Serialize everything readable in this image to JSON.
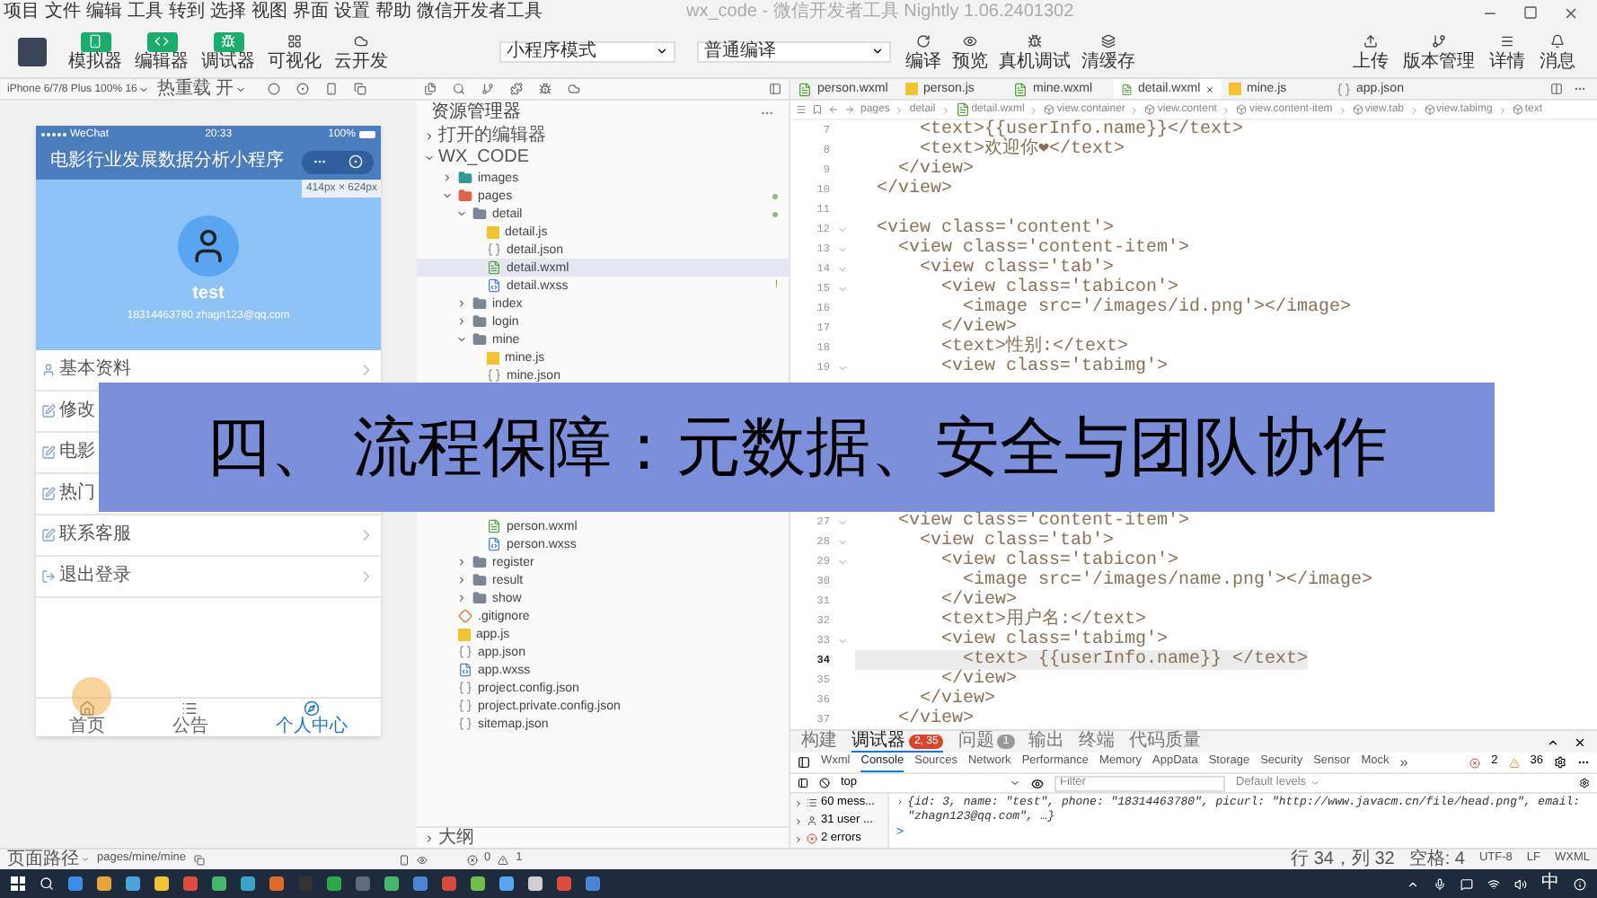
{
  "window": {
    "menu": [
      "项目",
      "文件",
      "编辑",
      "工具",
      "转到",
      "选择",
      "视图",
      "界面",
      "设置",
      "帮助",
      "微信开发者工具"
    ],
    "title": "wx_code - 微信开发者工具 Nightly 1.06.2401302"
  },
  "toolbar": {
    "toggles": [
      {
        "label": "模拟器",
        "kind": "phone",
        "on": true
      },
      {
        "label": "编辑器",
        "kind": "code",
        "on": true
      },
      {
        "label": "调试器",
        "kind": "debug",
        "on": true
      },
      {
        "label": "可视化",
        "kind": "grid",
        "on": false
      },
      {
        "label": "云开发",
        "kind": "cloud",
        "on": false
      }
    ],
    "mode": "小程序模式",
    "compile_mode": "普通编译",
    "actions": [
      {
        "label": "编译",
        "kind": "refresh"
      },
      {
        "label": "预览",
        "kind": "eye"
      },
      {
        "label": "真机调试",
        "kind": "bug"
      },
      {
        "label": "清缓存",
        "kind": "layers"
      }
    ],
    "right_actions": [
      {
        "label": "上传",
        "kind": "upload"
      },
      {
        "label": "版本管理",
        "kind": "branch"
      },
      {
        "label": "详情",
        "kind": "menu"
      },
      {
        "label": "消息",
        "kind": "bell"
      }
    ]
  },
  "simulator": {
    "device": "iPhone 6/7/8 Plus 100% 16",
    "hot_reload": "热重载 开",
    "status": {
      "carrier": "WeChat",
      "time": "20:33",
      "battery": "100%"
    },
    "nav_title": "电影行业发展数据分析小程序",
    "size_badge": "414px × 624px",
    "profile": {
      "name": "test",
      "contact": "18314463780 zhagn123@qq.com"
    },
    "menu": [
      {
        "label": "基本资料",
        "kind": "user",
        "chevron": true
      },
      {
        "label": "修改",
        "kind": "edit"
      },
      {
        "label": "电影",
        "kind": "edit"
      },
      {
        "label": "热门",
        "kind": "edit"
      },
      {
        "label": "联系客服",
        "kind": "edit",
        "chevron": true
      },
      {
        "label": "退出登录",
        "kind": "logout",
        "chevron": true
      }
    ],
    "tabbar": [
      {
        "label": "首页",
        "kind": "home",
        "selected": false
      },
      {
        "label": "公告",
        "kind": "list",
        "selected": false
      },
      {
        "label": "个人中心",
        "kind": "compass",
        "selected": true
      }
    ],
    "touch": true
  },
  "file_tree": {
    "title": "资源管理器",
    "sections": [
      {
        "name": "打开的编辑器",
        "expanded": false
      },
      {
        "name": "WX_CODE",
        "expanded": true,
        "items": [
          {
            "name": "images",
            "kind": "folder",
            "color": "#2f9a8f",
            "expanded": false,
            "selected": false
          },
          {
            "name": "pages",
            "kind": "folder",
            "color": "#e0604a",
            "expanded": true,
            "modified": true,
            "selected": false,
            "children": [
              {
                "name": "detail",
                "kind": "folder",
                "color": "#7a8797",
                "expanded": true,
                "modified": true,
                "selected": false,
                "children": [
                  {
                    "name": "detail.js",
                    "kind": "js",
                    "selected": false
                  },
                  {
                    "name": "detail.json",
                    "kind": "json",
                    "selected": false
                  },
                  {
                    "name": "detail.wxml",
                    "kind": "wxml",
                    "selected": true
                  },
                  {
                    "name": "detail.wxss",
                    "kind": "wxss",
                    "selected": false,
                    "badge": "!"
                  }
                ]
              },
              {
                "name": "index",
                "kind": "folder",
                "color": "#7a8797",
                "expanded": false,
                "selected": false
              },
              {
                "name": "login",
                "kind": "folder",
                "color": "#7a8797",
                "expanded": false,
                "selected": false
              },
              {
                "name": "mine",
                "kind": "folder",
                "color": "#7a8797",
                "expanded": true,
                "selected": false,
                "children": [
                  {
                    "name": "mine.js",
                    "kind": "js",
                    "selected": false
                  },
                  {
                    "name": "mine.json",
                    "kind": "json",
                    "selected": false
                  }
                ]
              },
              {
                "kind": "hidden",
                "children": [
                  {
                    "name": "person.wxml",
                    "kind": "wxml",
                    "selected": false
                  },
                  {
                    "name": "person.wxss",
                    "kind": "wxss",
                    "selected": false
                  }
                ]
              },
              {
                "name": "register",
                "kind": "folder",
                "color": "#7a8797",
                "expanded": false,
                "selected": false
              },
              {
                "name": "result",
                "kind": "folder",
                "color": "#7a8797",
                "expanded": false,
                "selected": false
              },
              {
                "name": "show",
                "kind": "folder",
                "color": "#7a8797",
                "expanded": false,
                "selected": false
              }
            ]
          },
          {
            "name": ".gitignore",
            "kind": "git",
            "selected": false
          },
          {
            "name": "app.js",
            "kind": "js",
            "selected": false
          },
          {
            "name": "app.json",
            "kind": "json",
            "selected": false
          },
          {
            "name": "app.wxss",
            "kind": "wxss",
            "selected": false
          },
          {
            "name": "project.config.json",
            "kind": "json",
            "selected": false
          },
          {
            "name": "project.private.config.json",
            "kind": "json",
            "selected": false
          },
          {
            "name": "sitemap.json",
            "kind": "json",
            "selected": false
          }
        ]
      }
    ],
    "outline": "大纲"
  },
  "editor": {
    "tabs": [
      {
        "name": "person.wxml",
        "kind": "wxml",
        "selected": false
      },
      {
        "name": "person.js",
        "kind": "js",
        "selected": false
      },
      {
        "name": "mine.wxml",
        "kind": "wxml",
        "selected": false
      },
      {
        "name": "detail.wxml",
        "kind": "wxml",
        "selected": true
      },
      {
        "name": "mine.js",
        "kind": "js",
        "selected": false
      },
      {
        "name": "app.json",
        "kind": "json",
        "selected": false
      }
    ],
    "breadcrumb": [
      {
        "label": "pages",
        "kind": "plain"
      },
      {
        "label": "detail",
        "kind": "plain"
      },
      {
        "label": "detail.wxml",
        "kind": "wxml"
      },
      {
        "label": "view.container",
        "kind": "element"
      },
      {
        "label": "view.content",
        "kind": "element"
      },
      {
        "label": "view.content-item",
        "kind": "element"
      },
      {
        "label": "view.tab",
        "kind": "element"
      },
      {
        "label": "view.tabimg",
        "kind": "element"
      },
      {
        "label": "text",
        "kind": "element"
      }
    ],
    "code_blocks": [
      {
        "lines": [
          {
            "n": "7",
            "text": "      <text>{{userInfo.name}}</text>",
            "fold": false,
            "current": false
          },
          {
            "n": "8",
            "text": "      <text>欢迎你❤</text>",
            "fold": false,
            "current": false
          },
          {
            "n": "9",
            "text": "    </view>",
            "fold": false,
            "current": false
          },
          {
            "n": "10",
            "text": "  </view>",
            "fold": false,
            "current": false
          },
          {
            "n": "11",
            "fold": false,
            "current": false
          },
          {
            "n": "12",
            "text": "  <view class='content'>",
            "fold": true,
            "current": false
          },
          {
            "n": "13",
            "text": "    <view class='content-item'>",
            "fold": true,
            "current": false
          },
          {
            "n": "14",
            "text": "      <view class='tab'>",
            "fold": true,
            "current": false
          },
          {
            "n": "15",
            "text": "        <view class='tabicon'>",
            "fold": true,
            "current": false
          },
          {
            "n": "16",
            "text": "          <image src='/images/id.png'></image>",
            "fold": false,
            "current": false
          },
          {
            "n": "17",
            "text": "        </view>",
            "fold": false,
            "current": false
          },
          {
            "n": "18",
            "text": "        <text>性别:</text>",
            "fold": false,
            "current": false
          },
          {
            "n": "19",
            "text": "        <view class='tabimg'>",
            "fold": true,
            "current": false
          }
        ]
      },
      {
        "lines": [
          {
            "n": "27",
            "text": "    <view class='content-item'>",
            "fold": true,
            "current": false
          },
          {
            "n": "28",
            "text": "      <view class='tab'>",
            "fold": true,
            "current": false
          },
          {
            "n": "29",
            "text": "        <view class='tabicon'>",
            "fold": true,
            "current": false
          },
          {
            "n": "30",
            "text": "          <image src='/images/name.png'></image>",
            "fold": false,
            "current": false
          },
          {
            "n": "31",
            "text": "        </view>",
            "fold": false,
            "current": false
          },
          {
            "n": "32",
            "text": "        <text>用户名:</text>",
            "fold": false,
            "current": false
          },
          {
            "n": "33",
            "text": "        <view class='tabimg'>",
            "fold": true,
            "current": false
          },
          {
            "n": "34",
            "text": "          <text> {{userInfo.name}} </text>",
            "fold": false,
            "current": true
          },
          {
            "n": "35",
            "text": "        </view>",
            "fold": false,
            "current": false
          },
          {
            "n": "36",
            "text": "      </view>",
            "fold": false,
            "current": false
          },
          {
            "n": "37",
            "text": "    </view>",
            "fold": false,
            "current": false
          }
        ]
      }
    ]
  },
  "devtools": {
    "panels": [
      {
        "label": "构建",
        "selected": false
      },
      {
        "label": "调试器",
        "selected": true,
        "badge": "2, 35",
        "color": "#d9452f"
      },
      {
        "label": "问题",
        "selected": false,
        "badge": "1",
        "color": "#999999"
      },
      {
        "label": "输出",
        "selected": false
      },
      {
        "label": "终端",
        "selected": false
      },
      {
        "label": "代码质量",
        "selected": false
      }
    ],
    "tabs": [
      {
        "label": "Wxml",
        "selected": false
      },
      {
        "label": "Console",
        "selected": true
      },
      {
        "label": "Sources",
        "selected": false
      },
      {
        "label": "Network",
        "selected": false
      },
      {
        "label": "Performance",
        "selected": false
      },
      {
        "label": "Memory",
        "selected": false
      },
      {
        "label": "AppData",
        "selected": false
      },
      {
        "label": "Storage",
        "selected": false
      },
      {
        "label": "Security",
        "selected": false
      },
      {
        "label": "Sensor",
        "selected": false
      },
      {
        "label": "Mock",
        "selected": false
      }
    ],
    "more": "»",
    "errors": "2",
    "warnings": "36",
    "context": "top",
    "filter_placeholder": "Filter",
    "levels": "Default levels",
    "sidebar": [
      {
        "label": "60 mess...",
        "kind": "messages"
      },
      {
        "label": "31 user ...",
        "kind": "user"
      },
      {
        "label": "2 errors",
        "kind": "error"
      }
    ],
    "output": "{id: 3, name: \"test\", phone: \"18314463780\", picurl: \"http://www.javacm.cn/file/head.png\", email: \"zhagn123@qq.com\", …}",
    "prompt": ">"
  },
  "status_bar": {
    "path_label": "页面路径",
    "path": "pages/mine/mine",
    "errors": "0",
    "warnings": "1",
    "position": "行 34，列 32",
    "indent": "空格: 4",
    "encoding": "UTF-8",
    "eol": "LF",
    "language": "WXML"
  },
  "taskbar": {
    "ime": "中"
  },
  "banner": {
    "text": "四、 流程保障：元数据、安全与团队协作"
  }
}
